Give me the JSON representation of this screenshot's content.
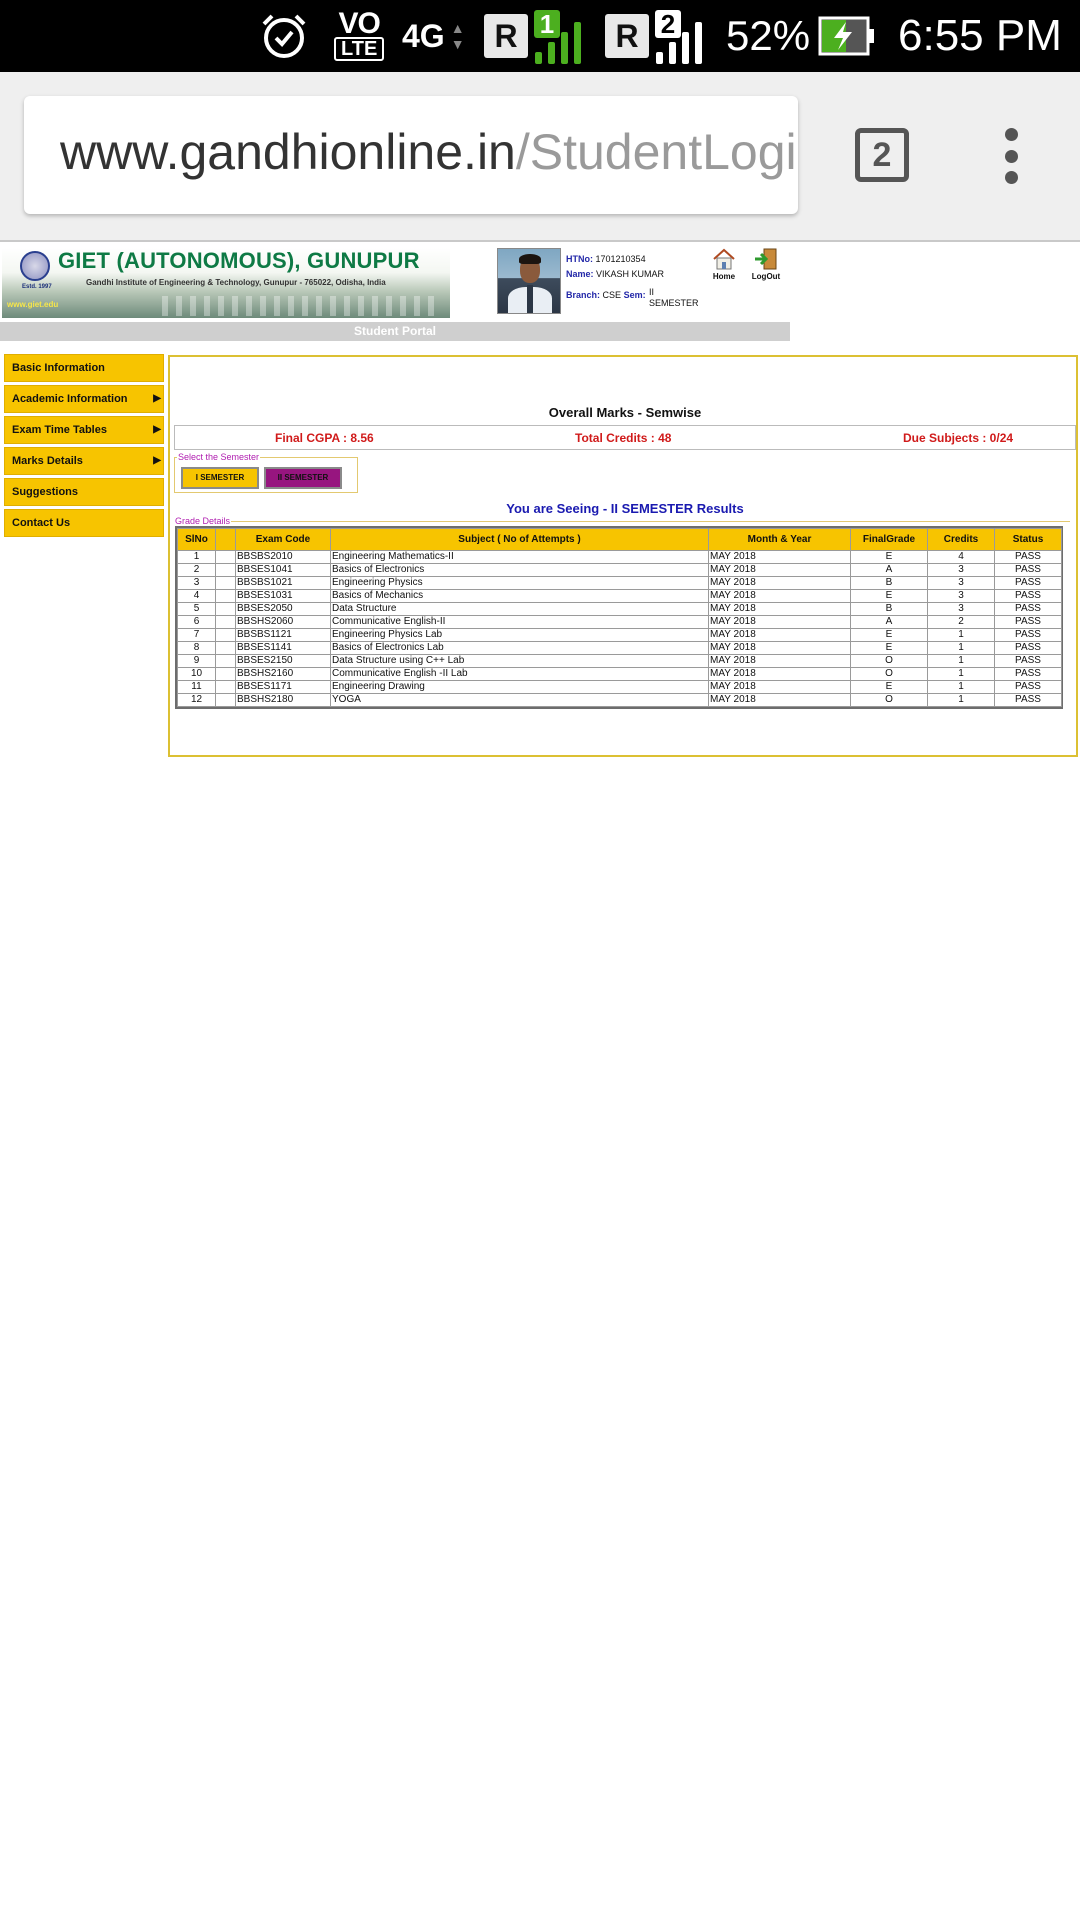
{
  "statusbar": {
    "battery_pct": "52%",
    "time": "6:55 PM",
    "network": "4G",
    "volte_top": "VO",
    "volte_bottom": "LTE",
    "sim1_label": "R",
    "sim1_num": "1",
    "sim2_label": "R",
    "sim2_num": "2",
    "icons": [
      "alarm-icon",
      "volte-icon",
      "data-arrows-icon",
      "signal-icon",
      "battery-charging-icon"
    ],
    "colors": {
      "sim1_accent": "#4caf1f"
    }
  },
  "browser": {
    "url_host": "www.gandhionline.in",
    "url_path": "/StudentLogi",
    "tab_count": "2",
    "icons": [
      "tabs-icon",
      "overflow-menu-icon"
    ]
  },
  "header": {
    "banner_title": "GIET (AUTONOMOUS), GUNUPUR",
    "banner_subtitle": "Gandhi Institute of Engineering & Technology, Gunupur - 765022, Odisha, India",
    "banner_estd": "Estd. 1997",
    "banner_website": "www.giet.edu",
    "profile": {
      "htno_label": "HTNo:",
      "htno": "1701210354",
      "name_label": "Name:",
      "name": "VIKASH KUMAR",
      "branch_label": "Branch:",
      "branch": "CSE",
      "sem_label": "Sem:",
      "sem": "II SEMESTER"
    },
    "home_label": "Home",
    "logout_label": "LogOut",
    "portal_title": "Student Portal"
  },
  "sidebar": {
    "items": [
      {
        "label": "Basic Information",
        "has_submenu": false
      },
      {
        "label": "Academic Information",
        "has_submenu": true
      },
      {
        "label": "Exam Time Tables",
        "has_submenu": true
      },
      {
        "label": "Marks Details",
        "has_submenu": true
      },
      {
        "label": "Suggestions",
        "has_submenu": false
      },
      {
        "label": "Contact Us",
        "has_submenu": false
      }
    ],
    "submenu_arrow": "▶"
  },
  "main": {
    "title": "Overall Marks - Semwise",
    "final_cgpa": "Final CGPA : 8.56",
    "total_credits": "Total Credits : 48",
    "due_subjects": "Due Subjects : 0/24",
    "semester_legend": "Select the Semester",
    "semester_buttons": [
      "I SEMESTER",
      "II SEMESTER"
    ],
    "seeing_text": "You are Seeing - II SEMESTER Results",
    "grade_legend": "Grade Details",
    "table": {
      "columns": [
        "SlNo",
        "",
        "Exam Code",
        "Subject ( No of Attempts )",
        "Month & Year",
        "FinalGrade",
        "Credits",
        "Status"
      ],
      "rows": [
        [
          "1",
          "",
          "BBSBS2010",
          "Engineering Mathematics-II",
          "MAY 2018",
          "E",
          "4",
          "PASS"
        ],
        [
          "2",
          "",
          "BBSES1041",
          "Basics of Electronics",
          "MAY 2018",
          "A",
          "3",
          "PASS"
        ],
        [
          "3",
          "",
          "BBSBS1021",
          "Engineering Physics",
          "MAY 2018",
          "B",
          "3",
          "PASS"
        ],
        [
          "4",
          "",
          "BBSES1031",
          "Basics of Mechanics",
          "MAY 2018",
          "E",
          "3",
          "PASS"
        ],
        [
          "5",
          "",
          "BBSES2050",
          "Data Structure",
          "MAY 2018",
          "B",
          "3",
          "PASS"
        ],
        [
          "6",
          "",
          "BBSHS2060",
          "Communicative English-II",
          "MAY 2018",
          "A",
          "2",
          "PASS"
        ],
        [
          "7",
          "",
          "BBSBS1121",
          "Engineering Physics Lab",
          "MAY 2018",
          "E",
          "1",
          "PASS"
        ],
        [
          "8",
          "",
          "BBSES1141",
          "Basics of Electronics Lab",
          "MAY 2018",
          "E",
          "1",
          "PASS"
        ],
        [
          "9",
          "",
          "BBSES2150",
          "Data Structure using C++ Lab",
          "MAY 2018",
          "O",
          "1",
          "PASS"
        ],
        [
          "10",
          "",
          "BBSHS2160",
          "Communicative English -II Lab",
          "MAY 2018",
          "O",
          "1",
          "PASS"
        ],
        [
          "11",
          "",
          "BBSES1171",
          "Engineering Drawing",
          "MAY 2018",
          "E",
          "1",
          "PASS"
        ],
        [
          "12",
          "",
          "BBSHS2180",
          "YOGA",
          "MAY 2018",
          "O",
          "1",
          "PASS"
        ]
      ]
    },
    "colors": {
      "accent_yellow": "#f7c400",
      "active_semester": "#97157f",
      "summary_red": "#d01a1a",
      "seeing_blue": "#1a1ab0"
    }
  }
}
